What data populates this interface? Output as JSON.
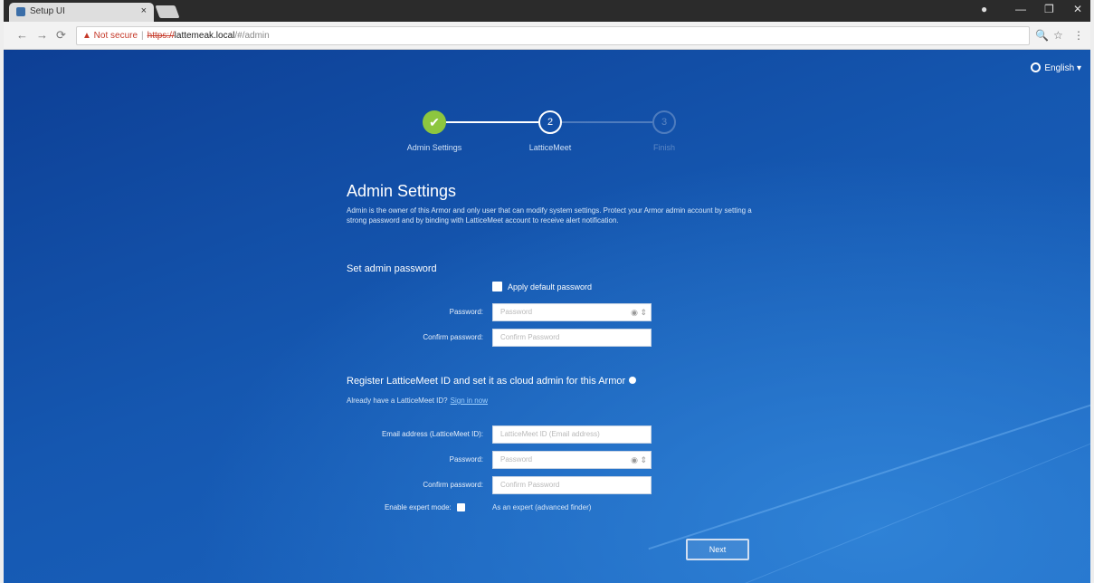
{
  "browser": {
    "tab_title": "Setup UI",
    "tab_close": "×",
    "win_profile": "●",
    "win_minimize": "—",
    "win_maximize": "❐",
    "win_close": "✕",
    "nav_back": "←",
    "nav_forward": "→",
    "nav_reload": "⟳",
    "address_warning": "▲ Not secure",
    "address_sep": "|",
    "address_scheme": "https://",
    "address_host": "lattemeak.local",
    "address_path": "/#/admin",
    "zoom_icon": "🔍",
    "star_icon": "☆",
    "menu_icon": "⋮"
  },
  "page": {
    "language": "English",
    "language_caret": "▾",
    "steps": [
      {
        "label": "Admin Settings",
        "mark": "✔",
        "state": "done"
      },
      {
        "label": "LatticeMeet",
        "mark": "2",
        "state": "current"
      },
      {
        "label": "Finish",
        "mark": "3",
        "state": "pending"
      }
    ],
    "title": "Admin Settings",
    "description": "Admin is the owner of this Armor and only user that can modify system settings. Protect your Armor admin account by setting a strong password and by binding with LatticeMeet account to receive alert notification.",
    "section_password": "Set admin password",
    "apply_default_label": "Apply default password",
    "password_label": "Password:",
    "password_placeholder": "Password",
    "confirm_label": "Confirm password:",
    "confirm_placeholder": "Confirm Password",
    "section_register": "Register LatticeMeet ID and set it as cloud admin for this Armor",
    "already_text": "Already have a LatticeMeet ID?",
    "already_link": "Sign in now",
    "email_label": "Email address (LatticeMeet ID):",
    "email_placeholder": "LatticeMeet ID (Email address)",
    "password2_label": "Password:",
    "password2_placeholder": "Password",
    "confirm2_label": "Confirm password:",
    "confirm2_placeholder": "Confirm Password",
    "expert_label": "Enable expert mode:",
    "expert_text": "As an expert (advanced finder)",
    "next_label": "Next",
    "eye_icon": "◉",
    "spin_icon": "⇕"
  }
}
